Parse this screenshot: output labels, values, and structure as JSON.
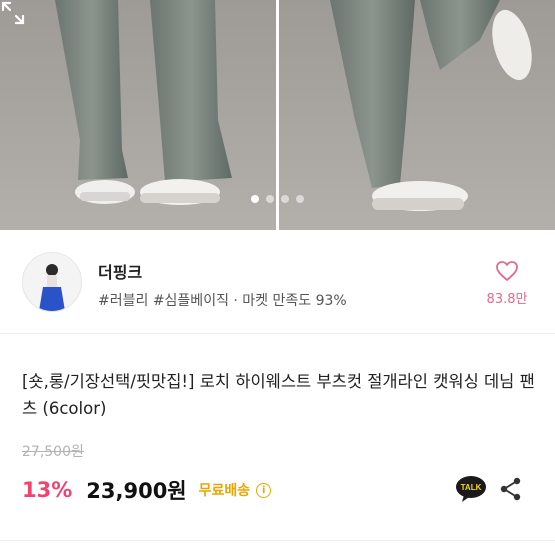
{
  "gallery": {
    "image_alt": "product-photo-wide-leg-jeans",
    "slide_count": 4,
    "active_slide": 1
  },
  "seller": {
    "name": "더핑크",
    "tags": "#러블리 #심플베이직 · 마켓 만족도 93%",
    "like_count": "83.8만"
  },
  "product": {
    "title": "[숏,롱/기장선택/핏맛집!] 로치 하이웨스트 부츠컷 절개라인 캣워싱 데님 팬츠 (6color)",
    "original_price": "27,500원",
    "discount": "13%",
    "price": "23,900원",
    "shipping": "무료배송",
    "talk_label": "TALK"
  },
  "colors": {
    "discount": "#f0436e",
    "shipping": "#e8a700",
    "like": "#e46a8a",
    "talk_bg": "#1a1a1a",
    "talk_text": "#f7d90f"
  }
}
